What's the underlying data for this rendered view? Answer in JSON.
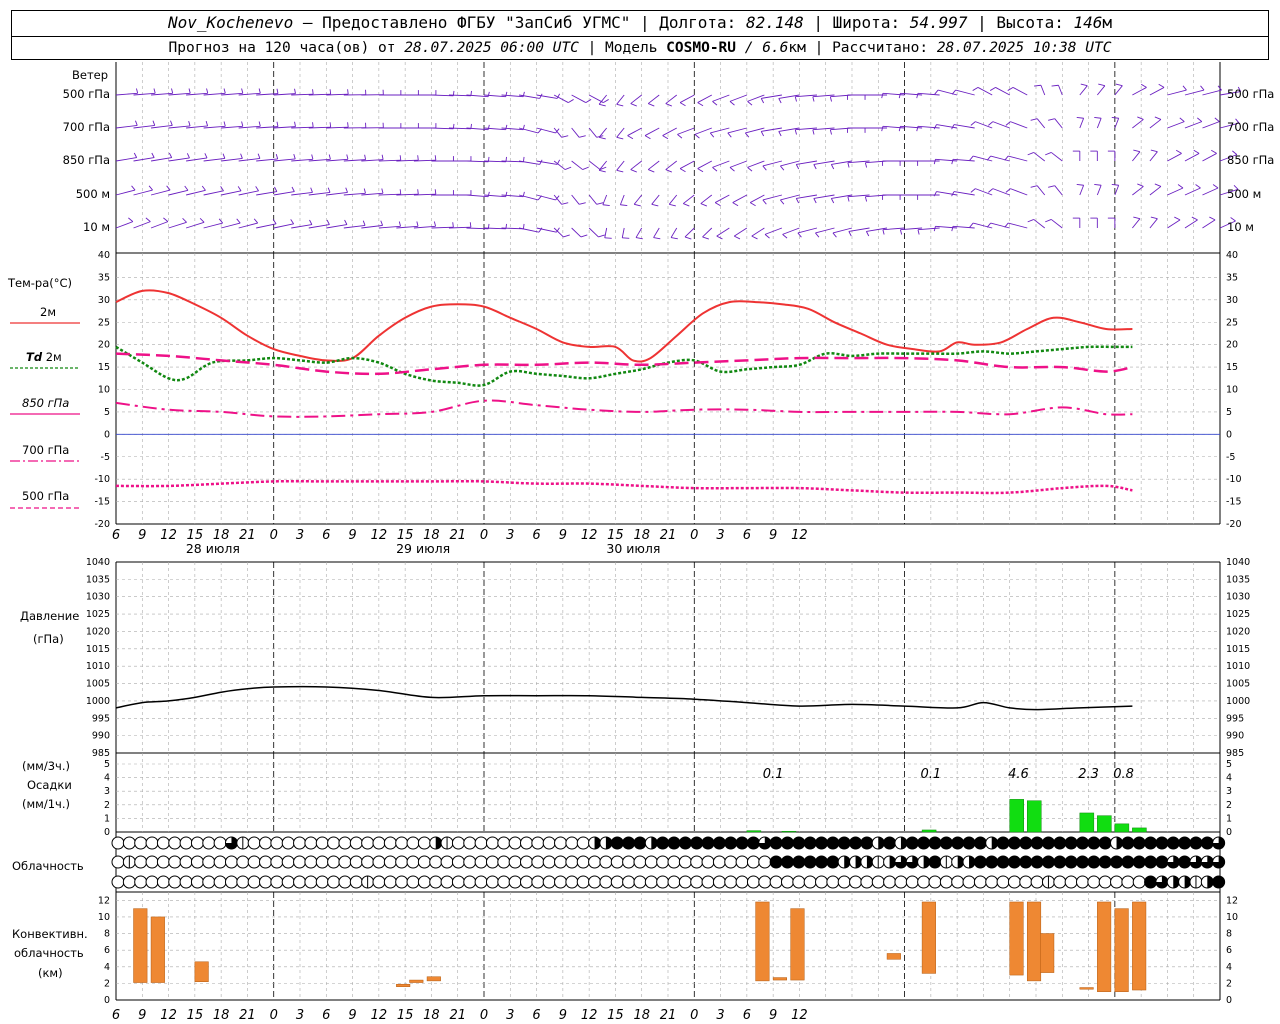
{
  "header": {
    "station": "Nov_Kochenevo",
    "provider": " – Предоставлено ФГБУ \"ЗапСиб УГМС\" | Долгота: ",
    "lon": "82.148",
    "lat_label": " | Широта: ",
    "lat": "54.997",
    "alt_label": " | Высота: ",
    "alt": "146",
    "alt_unit": "м",
    "forecast_label": "Прогноз на 120 часа(ов) от ",
    "forecast_from": "28.07.2025 06:00 UTC",
    "model_label": " | Модель ",
    "model": "COSMO-RU",
    "model_res": " / 6.6",
    "model_res_unit": "км",
    "calc_label": " | Рассчитано: ",
    "calc_time": "28.07.2025 10:38 UTC"
  },
  "labels": {
    "wind": "Ветер",
    "wind_levels": [
      "500 гПа",
      "700 гПа",
      "850 гПа",
      "500 м",
      "10 м"
    ],
    "temp": "Тем-ра(°С)",
    "legend": [
      {
        "text": "2м",
        "prefix": "",
        "color": "#ee3333"
      },
      {
        "text": " 2м",
        "prefix": "Td",
        "color": "#118811"
      },
      {
        "text": "850 гПа",
        "prefix": "",
        "color": "#ee1188"
      },
      {
        "text": "700 гПа",
        "prefix": "",
        "color": "#ee1188"
      },
      {
        "text": "500 гПа",
        "prefix": "",
        "color": "#ee1188"
      }
    ],
    "pressure": "Давление",
    "pressure_unit": "(гПа)",
    "precip_unit3": "(мм/3ч.)",
    "precip": "Осадки",
    "precip_unit1": "(мм/1ч.)",
    "clouds": "Облачность",
    "conv1": "Конвективн.",
    "conv2": "облачность",
    "conv3": "(км)"
  },
  "chart_data": [
    {
      "type": "line",
      "title": "Тем-ра(°С)",
      "x_hours_from_start": "0..126",
      "x_tick_labels": [
        "6",
        "9",
        "12",
        "15",
        "18",
        "21",
        "0",
        "3",
        "6",
        "9",
        "12",
        "15",
        "18",
        "21",
        "0",
        "3",
        "6",
        "9",
        "12",
        "15",
        "18",
        "21",
        "0",
        "3",
        "6",
        "9",
        "12"
      ],
      "date_labels": [
        "28 июля",
        "29 июля",
        "30 июля"
      ],
      "ylim": [
        -20,
        40
      ],
      "y_ticks": [
        -20,
        -15,
        -10,
        -5,
        0,
        5,
        10,
        15,
        20,
        25,
        30,
        35,
        40
      ],
      "series": [
        {
          "name": "2м",
          "values": [
            [
              0,
              29.5
            ],
            [
              3,
              32
            ],
            [
              6,
              31.5
            ],
            [
              9,
              29
            ],
            [
              12,
              26
            ],
            [
              15,
              22
            ],
            [
              18,
              19
            ],
            [
              21,
              17.5
            ],
            [
              24,
              16.5
            ],
            [
              27,
              17
            ],
            [
              30,
              22
            ],
            [
              33,
              26
            ],
            [
              36,
              28.5
            ],
            [
              39,
              29
            ],
            [
              42,
              28.5
            ],
            [
              45,
              26
            ],
            [
              48,
              23.5
            ],
            [
              51,
              20.5
            ],
            [
              54,
              19.5
            ],
            [
              57,
              19.5
            ],
            [
              59,
              16.5
            ],
            [
              61,
              17
            ],
            [
              64,
              22
            ],
            [
              67,
              27
            ],
            [
              70,
              29.5
            ],
            [
              73,
              29.5
            ],
            [
              76,
              29
            ],
            [
              79,
              28
            ],
            [
              82,
              25
            ],
            [
              85,
              22.5
            ],
            [
              88,
              20
            ],
            [
              91,
              19
            ],
            [
              94,
              18.5
            ],
            [
              96,
              20.5
            ],
            [
              98,
              20
            ],
            [
              101,
              20.5
            ],
            [
              104,
              23.5
            ],
            [
              107,
              26
            ],
            [
              110,
              25
            ],
            [
              113,
              23.5
            ],
            [
              116,
              23.5
            ]
          ]
        },
        {
          "name": "Td 2м",
          "values": [
            [
              0,
              19.5
            ],
            [
              3,
              16
            ],
            [
              6,
              12.5
            ],
            [
              8,
              12.5
            ],
            [
              11,
              16
            ],
            [
              15,
              16.5
            ],
            [
              18,
              17
            ],
            [
              21,
              16.5
            ],
            [
              24,
              16
            ],
            [
              27,
              17
            ],
            [
              30,
              16
            ],
            [
              33,
              13.5
            ],
            [
              36,
              12
            ],
            [
              39,
              11.5
            ],
            [
              42,
              11
            ],
            [
              45,
              14
            ],
            [
              48,
              13.5
            ],
            [
              51,
              13
            ],
            [
              54,
              12.5
            ],
            [
              57,
              13.5
            ],
            [
              60,
              14.5
            ],
            [
              63,
              16
            ],
            [
              66,
              16.5
            ],
            [
              69,
              14
            ],
            [
              72,
              14.5
            ],
            [
              75,
              15
            ],
            [
              78,
              15.5
            ],
            [
              81,
              18
            ],
            [
              84,
              17.5
            ],
            [
              87,
              18
            ],
            [
              90,
              18
            ],
            [
              93,
              18
            ],
            [
              96,
              18
            ],
            [
              99,
              18.5
            ],
            [
              102,
              18
            ],
            [
              105,
              18.5
            ],
            [
              108,
              19
            ],
            [
              111,
              19.5
            ],
            [
              114,
              19.5
            ],
            [
              116,
              19.5
            ]
          ]
        },
        {
          "name": "850 гПа",
          "values": [
            [
              0,
              18
            ],
            [
              6,
              17.5
            ],
            [
              12,
              16.5
            ],
            [
              18,
              15.5
            ],
            [
              24,
              14
            ],
            [
              30,
              13.5
            ],
            [
              36,
              14.5
            ],
            [
              42,
              15.5
            ],
            [
              48,
              15.5
            ],
            [
              54,
              16
            ],
            [
              60,
              15.5
            ],
            [
              66,
              16
            ],
            [
              72,
              16.5
            ],
            [
              78,
              17
            ],
            [
              84,
              17
            ],
            [
              90,
              17
            ],
            [
              96,
              16.5
            ],
            [
              102,
              15
            ],
            [
              108,
              15
            ],
            [
              113,
              14
            ],
            [
              116,
              15
            ]
          ]
        },
        {
          "name": "700 гПа",
          "values": [
            [
              0,
              7
            ],
            [
              6,
              5.5
            ],
            [
              12,
              5
            ],
            [
              18,
              4
            ],
            [
              24,
              4
            ],
            [
              30,
              4.5
            ],
            [
              36,
              5
            ],
            [
              42,
              7.5
            ],
            [
              48,
              6.5
            ],
            [
              54,
              5.5
            ],
            [
              60,
              5
            ],
            [
              66,
              5.5
            ],
            [
              72,
              5.5
            ],
            [
              78,
              5
            ],
            [
              84,
              5
            ],
            [
              90,
              5
            ],
            [
              96,
              5
            ],
            [
              102,
              4.5
            ],
            [
              108,
              6
            ],
            [
              113,
              4.5
            ],
            [
              116,
              4.5
            ]
          ]
        },
        {
          "name": "500 гПа",
          "values": [
            [
              0,
              -11.5
            ],
            [
              6,
              -11.5
            ],
            [
              12,
              -11
            ],
            [
              18,
              -10.5
            ],
            [
              24,
              -10.5
            ],
            [
              30,
              -10.5
            ],
            [
              36,
              -10.5
            ],
            [
              42,
              -10.5
            ],
            [
              48,
              -11
            ],
            [
              54,
              -11
            ],
            [
              60,
              -11.5
            ],
            [
              66,
              -12
            ],
            [
              72,
              -12
            ],
            [
              78,
              -12
            ],
            [
              84,
              -12.5
            ],
            [
              90,
              -13
            ],
            [
              96,
              -13
            ],
            [
              102,
              -13
            ],
            [
              108,
              -12
            ],
            [
              113,
              -11.5
            ],
            [
              116,
              -12.5
            ]
          ]
        }
      ]
    },
    {
      "type": "line",
      "title": "Давление",
      "ylabel": "(гПа)",
      "ylim": [
        985,
        1040
      ],
      "y_ticks": [
        985,
        990,
        995,
        1000,
        1005,
        1010,
        1015,
        1020,
        1025,
        1030,
        1035,
        1040
      ],
      "series": [
        {
          "name": "",
          "values": [
            [
              0,
              998
            ],
            [
              3,
              999.5
            ],
            [
              6,
              1000
            ],
            [
              9,
              1001
            ],
            [
              12,
              1002.5
            ],
            [
              15,
              1003.5
            ],
            [
              18,
              1004
            ],
            [
              24,
              1004
            ],
            [
              30,
              1003
            ],
            [
              36,
              1001
            ],
            [
              42,
              1001.5
            ],
            [
              48,
              1001.5
            ],
            [
              54,
              1001.5
            ],
            [
              60,
              1001
            ],
            [
              66,
              1000.5
            ],
            [
              72,
              999.5
            ],
            [
              78,
              998.5
            ],
            [
              84,
              999
            ],
            [
              90,
              998.5
            ],
            [
              96,
              998
            ],
            [
              99,
              999.5
            ],
            [
              102,
              998
            ],
            [
              105,
              997.5
            ],
            [
              110,
              998
            ],
            [
              116,
              998.5
            ]
          ]
        }
      ]
    },
    {
      "type": "bar",
      "title": "Осадки",
      "ylim": [
        0,
        5
      ],
      "y_ticks": [
        0,
        1,
        2,
        3,
        4,
        5
      ],
      "bars": [
        [
          72,
          0.1
        ],
        [
          76,
          0.05
        ],
        [
          92,
          0.15
        ],
        [
          102,
          2.4
        ],
        [
          104,
          2.3
        ],
        [
          110,
          1.4
        ],
        [
          112,
          1.2
        ],
        [
          114,
          0.6
        ],
        [
          116,
          0.3
        ]
      ],
      "totals": [
        {
          "hour": 75,
          "text": "0.1"
        },
        {
          "hour": 93,
          "text": "0.1"
        },
        {
          "hour": 103,
          "text": "4.6"
        },
        {
          "hour": 111,
          "text": "2.3"
        },
        {
          "hour": 115,
          "text": "0.8"
        }
      ]
    },
    {
      "type": "bar",
      "title": "Конвективн. облачность (км)",
      "ylim": [
        0,
        13
      ],
      "y_ticks": [
        0,
        2,
        4,
        6,
        8,
        10,
        12
      ],
      "bars": [
        [
          2,
          2.1,
          11
        ],
        [
          4,
          2.1,
          10
        ],
        [
          9,
          2.2,
          4.6
        ],
        [
          32,
          1.6,
          1.9
        ],
        [
          33.5,
          2.1,
          2.4
        ],
        [
          35.5,
          2.3,
          2.8
        ],
        [
          73,
          2.3,
          11.8
        ],
        [
          75,
          2.4,
          2.7
        ],
        [
          77,
          2.4,
          11
        ],
        [
          88,
          4.9,
          5.6
        ],
        [
          92,
          3.2,
          11.8
        ],
        [
          102,
          3,
          11.8
        ],
        [
          104,
          2.3,
          11.8
        ],
        [
          105.5,
          3.3,
          8
        ],
        [
          110,
          1.3,
          1.5
        ],
        [
          112,
          1,
          11.8
        ],
        [
          114,
          1,
          11
        ],
        [
          116,
          1.2,
          11.8
        ]
      ]
    }
  ],
  "clouds": {
    "rows": [
      [
        0,
        0,
        0,
        0,
        0,
        0,
        0,
        0,
        0,
        0,
        3,
        1,
        0,
        0,
        0,
        0,
        0,
        0,
        0,
        0,
        0,
        0,
        0,
        0,
        0,
        0,
        0,
        0,
        2,
        1,
        0,
        0,
        0,
        0,
        0,
        0,
        0,
        0,
        0,
        0,
        0,
        0,
        2,
        2,
        4,
        4,
        4,
        2,
        4,
        4,
        4,
        4,
        4,
        4,
        4,
        4,
        4,
        3,
        4,
        4,
        4,
        4,
        4,
        4,
        4,
        4,
        4,
        2,
        4,
        2,
        4,
        4,
        4,
        4,
        4,
        4,
        4,
        2,
        4,
        4,
        4,
        4,
        4,
        4,
        4,
        4,
        4,
        4,
        2,
        4,
        4,
        4,
        4,
        4,
        4,
        4,
        4,
        3
      ],
      [
        0,
        1,
        0,
        0,
        0,
        0,
        0,
        0,
        0,
        0,
        0,
        0,
        0,
        0,
        0,
        0,
        0,
        0,
        0,
        0,
        0,
        0,
        0,
        0,
        0,
        0,
        0,
        0,
        0,
        0,
        0,
        0,
        0,
        0,
        0,
        0,
        0,
        0,
        0,
        0,
        0,
        0,
        0,
        0,
        0,
        0,
        0,
        0,
        0,
        0,
        0,
        0,
        0,
        0,
        0,
        0,
        0,
        0,
        4,
        4,
        4,
        4,
        4,
        4,
        2,
        2,
        2,
        1,
        2,
        3,
        3,
        2,
        4,
        1,
        2,
        2,
        4,
        4,
        4,
        4,
        4,
        4,
        4,
        4,
        4,
        4,
        4,
        4,
        4,
        4,
        4,
        4,
        4,
        3,
        4,
        3,
        3,
        3
      ],
      [
        0,
        0,
        0,
        0,
        0,
        0,
        0,
        0,
        0,
        0,
        0,
        0,
        0,
        0,
        0,
        0,
        0,
        0,
        0,
        0,
        0,
        0,
        1,
        0,
        0,
        0,
        0,
        0,
        0,
        0,
        0,
        0,
        0,
        0,
        0,
        0,
        0,
        0,
        0,
        0,
        0,
        0,
        0,
        0,
        0,
        0,
        0,
        0,
        0,
        0,
        0,
        0,
        0,
        0,
        0,
        0,
        0,
        0,
        0,
        0,
        0,
        0,
        0,
        0,
        0,
        0,
        0,
        0,
        0,
        0,
        0,
        0,
        0,
        0,
        0,
        0,
        0,
        0,
        0,
        0,
        0,
        0,
        1,
        0,
        0,
        0,
        0,
        0,
        0,
        0,
        0,
        4,
        3,
        2,
        2,
        1,
        2,
        4
      ]
    ]
  }
}
